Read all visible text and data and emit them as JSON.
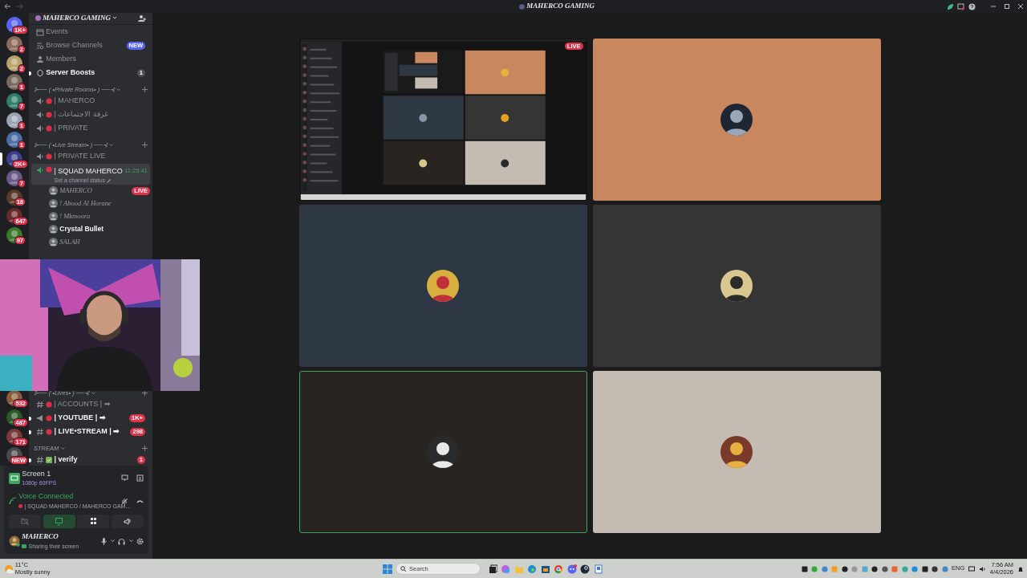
{
  "window": {
    "title": "MAHERCO GAMING"
  },
  "servers_top": [
    {
      "badge": "1K+",
      "selected": false,
      "color": "#5865f2"
    },
    {
      "badge": "2",
      "selected": false,
      "color": "#8a6a5a"
    },
    {
      "badge": "2",
      "selected": false,
      "color": "#b9a36a"
    },
    {
      "badge": "1",
      "selected": false,
      "color": "#7a6a5e"
    },
    {
      "badge": "7",
      "selected": false,
      "color": "#2f7d6a"
    },
    {
      "badge": "1",
      "selected": false,
      "color": "#9aa3b5"
    },
    {
      "badge": "1",
      "selected": false,
      "color": "#4a6fa5"
    },
    {
      "badge": "2K+",
      "selected": true,
      "color": "#3c3f8f"
    },
    {
      "badge": "7",
      "selected": false,
      "color": "#6a5a8a"
    },
    {
      "badge": "18",
      "selected": false,
      "color": "#5a3a2a"
    },
    {
      "badge": "647",
      "selected": false,
      "color": "#6a2a2a"
    },
    {
      "badge": "97",
      "selected": false,
      "color": "#3a7a2a"
    }
  ],
  "servers_bottom": [
    {
      "badge": "532",
      "selected": false,
      "color": "#8a5a3a"
    },
    {
      "badge": "487",
      "selected": false,
      "color": "#2a5a2a"
    },
    {
      "badge": "171",
      "selected": false,
      "color": "#7a3a3a"
    },
    {
      "badge": "NEW",
      "selected": false,
      "color": "#4a4a4a"
    }
  ],
  "sidebar": {
    "server_name": "MAHERCO GAMING",
    "channels_top": [
      {
        "kind": "nav",
        "label": "Events",
        "unread": false
      },
      {
        "kind": "nav",
        "label": "Browse Channels",
        "unread": false,
        "badge": {
          "text": "NEW",
          "kind": "new"
        }
      },
      {
        "kind": "nav",
        "label": "Members",
        "unread": false
      },
      {
        "kind": "nav",
        "label": "Server Boosts",
        "unread": true,
        "badge": {
          "text": "1",
          "kind": "count"
        }
      },
      {
        "kind": "category",
        "label": "⊱── ( •Private Rooms• ) ──⊰"
      },
      {
        "kind": "voice",
        "label": "| MAHERCO",
        "selected": false,
        "unread": false
      },
      {
        "kind": "voice",
        "label": "| غرفة الاجتماعات",
        "selected": false,
        "unread": false
      },
      {
        "kind": "voice",
        "label": "| PRIVATE",
        "selected": false,
        "unread": false
      },
      {
        "kind": "category",
        "label": "⊱── ( •Live Stream• ) ──⊰"
      },
      {
        "kind": "voice",
        "label": "| PRIVATE LIVE",
        "selected": false,
        "unread": false
      },
      {
        "kind": "voice",
        "label": "| SQUAD MAHERCO",
        "selected": true,
        "unread": false,
        "timer": "11:25:41",
        "status_hint": "Set a channel status"
      },
      {
        "kind": "member",
        "label": "MAHERCO",
        "badge": {
          "text": "LIVE",
          "kind": "live"
        },
        "highlighted": false
      },
      {
        "kind": "member",
        "label": "! Abood Al Horane",
        "highlighted": false
      },
      {
        "kind": "member",
        "label": "! Mkmoora",
        "highlighted": false
      },
      {
        "kind": "member",
        "label": "Crystal Bullet",
        "highlighted": true
      },
      {
        "kind": "member",
        "label": "SALAH",
        "highlighted": false
      }
    ],
    "channels_bottom": [
      {
        "kind": "category",
        "label": "⊱── ( •Lives• ) ──⊰"
      },
      {
        "kind": "text",
        "label": "| ACCOUNTS | ➡",
        "unread": false
      },
      {
        "kind": "announcement",
        "label": "| YOUTUBE | ➡",
        "unread": true,
        "badge": {
          "text": "1K+",
          "kind": "mention"
        }
      },
      {
        "kind": "text",
        "label": "| LIVE•STREAM | ➡",
        "unread": true,
        "badge": {
          "text": "298",
          "kind": "mention"
        }
      },
      {
        "kind": "category",
        "label": "STREAM"
      },
      {
        "kind": "verify",
        "label": "| verify",
        "unread": true,
        "badge": {
          "text": "1",
          "kind": "mention"
        }
      }
    ]
  },
  "stream_panel": {
    "title": "Screen 1",
    "quality": "1080p 60FPS"
  },
  "voice_panel": {
    "status": "Voice Connected",
    "channel": "| SQUAD MAHERCO / MAHERCO GAM..."
  },
  "voice_buttons": [
    {
      "kind": "camera",
      "active": false
    },
    {
      "kind": "screen",
      "active": true
    },
    {
      "kind": "activities",
      "active": false
    },
    {
      "kind": "soundboard",
      "active": false
    }
  ],
  "user": {
    "name": "MAHERCO",
    "status": "Sharing their screen"
  },
  "tiles": [
    {
      "kind": "screen",
      "badge": "LIVE",
      "speaking": false,
      "color": "#141414"
    },
    {
      "kind": "avatar",
      "speaking": false,
      "color": "#c8875e"
    },
    {
      "kind": "avatar",
      "speaking": false,
      "color": "#2e3744"
    },
    {
      "kind": "avatar",
      "speaking": false,
      "color": "#363535"
    },
    {
      "kind": "avatar",
      "speaking": true,
      "color": "#29241f"
    },
    {
      "kind": "avatar",
      "speaking": false,
      "color": "#c4bcb3"
    }
  ],
  "taskbar": {
    "temperature": "11°C",
    "weather": "Mostly sunny",
    "search_placeholder": "Search",
    "language": "ENG",
    "time": "7:56 AM",
    "date": "4/4/2026"
  }
}
